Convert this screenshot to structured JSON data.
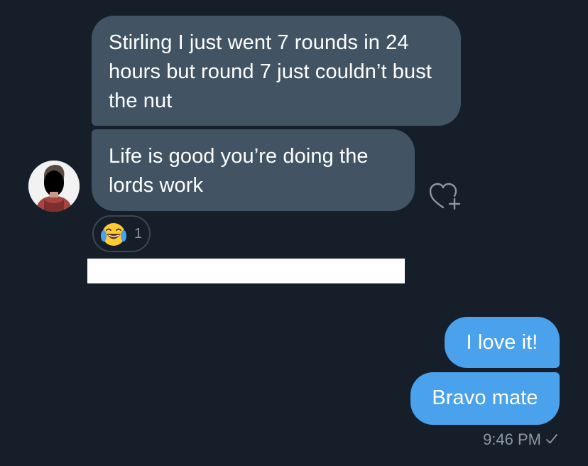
{
  "conversation": {
    "incoming": [
      {
        "text": "Stirling I just went 7 rounds in 24 hours but round 7 just couldn’t bust the nut"
      },
      {
        "text": "Life is good you’re doing the lords work"
      }
    ],
    "outgoing": [
      {
        "text": "I love it!"
      },
      {
        "text": "Bravo mate"
      }
    ],
    "reaction": {
      "emoji_icon": "face-with-tears-of-joy-icon",
      "count": "1"
    },
    "timestamp": "9:46 PM",
    "status_icon": "checkmark-icon"
  },
  "colors": {
    "background": "#161e2a",
    "incoming_bubble": "#425464",
    "outgoing_bubble": "#4aa1ec",
    "meta_text": "#8b98a5"
  }
}
